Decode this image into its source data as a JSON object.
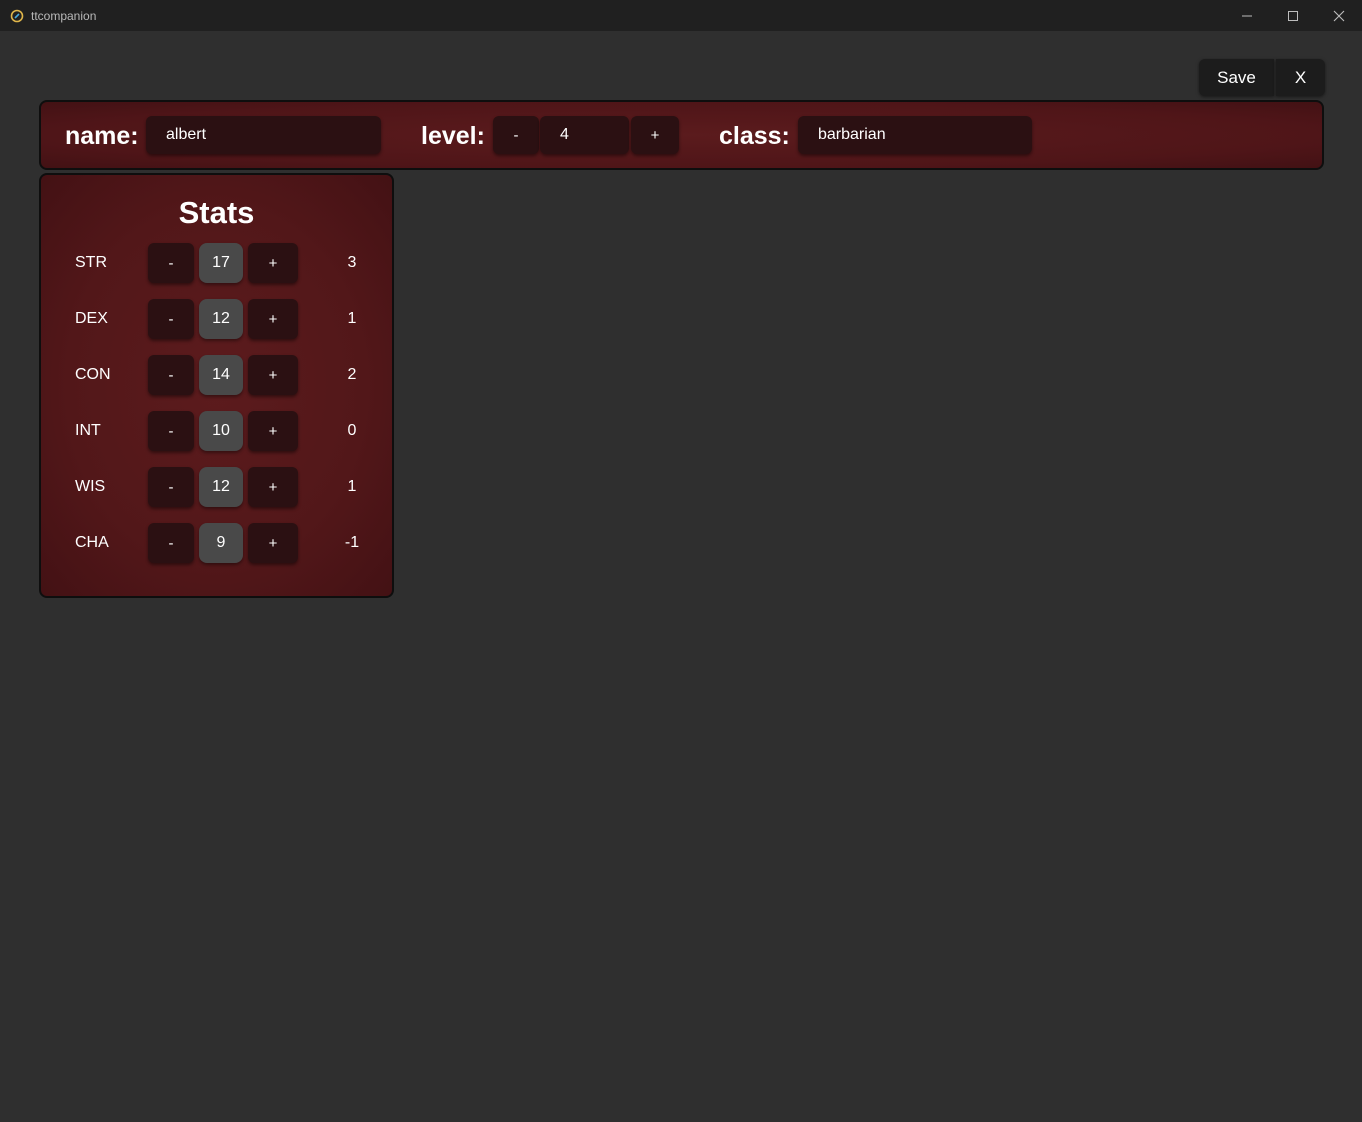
{
  "window": {
    "title": "ttcompanion",
    "icon": "link-icon",
    "controls": [
      "minimize-icon",
      "maximize-icon",
      "close-icon"
    ]
  },
  "toolbar": {
    "save_label": "Save",
    "close_label": "X"
  },
  "header": {
    "name_label": "name:",
    "name_value": "albert",
    "level_label": "level:",
    "level_decrement": "-",
    "level_value": "4",
    "level_increment": "+",
    "class_label": "class:",
    "class_value": "barbarian"
  },
  "stats": {
    "title": "Stats",
    "decrement_label": "-",
    "increment_label": "+",
    "rows": [
      {
        "name": "STR",
        "value": "17",
        "modifier": "3"
      },
      {
        "name": "DEX",
        "value": "12",
        "modifier": "1"
      },
      {
        "name": "CON",
        "value": "14",
        "modifier": "2"
      },
      {
        "name": "INT",
        "value": "10",
        "modifier": "0"
      },
      {
        "name": "WIS",
        "value": "12",
        "modifier": "1"
      },
      {
        "name": "CHA",
        "value": "9",
        "modifier": "-1"
      }
    ]
  },
  "colors": {
    "background": "#2f2f2f",
    "titlebar": "#202020",
    "panel_red": "#521719",
    "control_dark": "#2b1012",
    "stat_value_bg": "#494949"
  }
}
